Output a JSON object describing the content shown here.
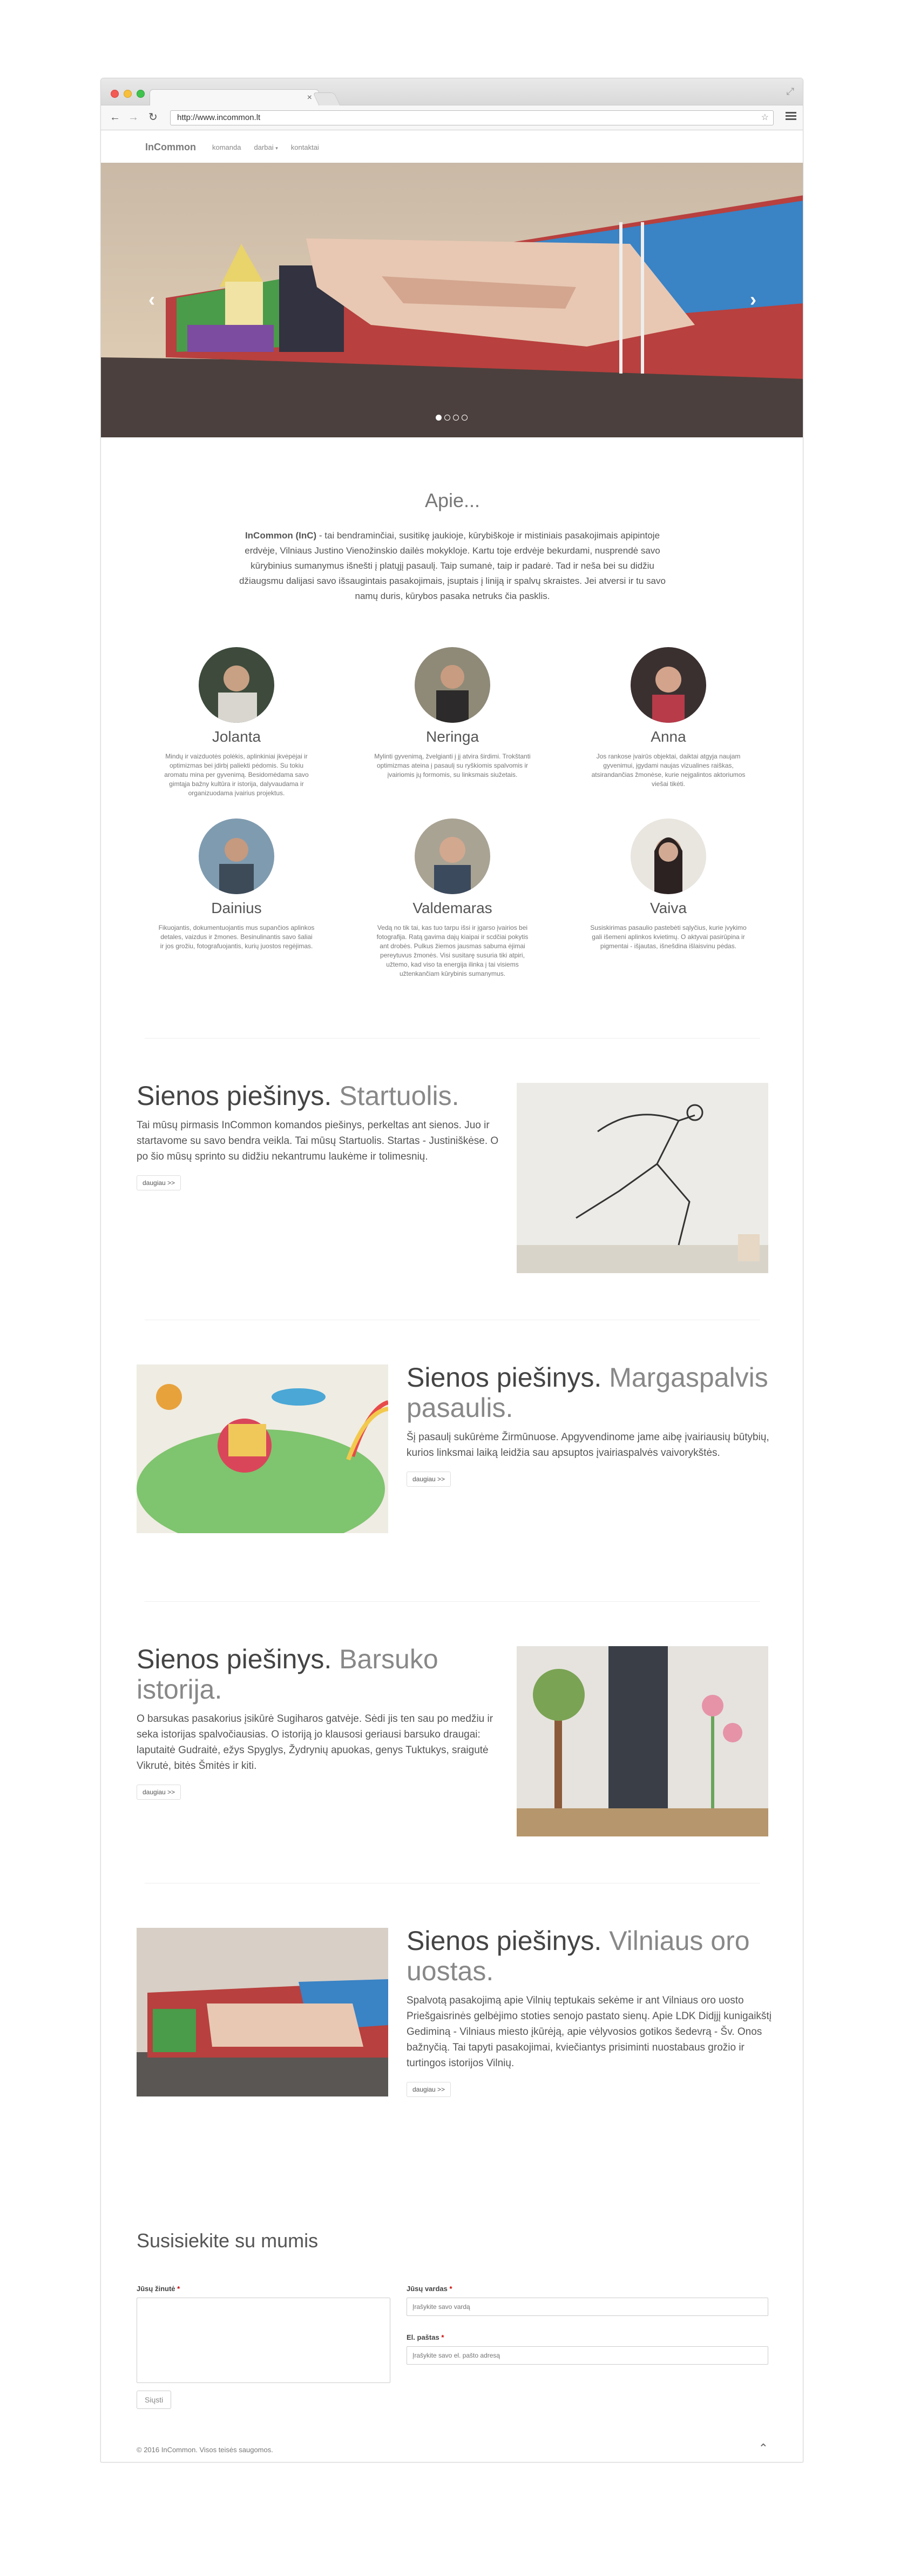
{
  "browser": {
    "url": "http://www.incommon.lt",
    "tab_close": "×",
    "back": "←",
    "forward": "→",
    "reload": "↻",
    "star": "☆",
    "resize": "⤢"
  },
  "nav": {
    "brand": "InCommon",
    "links": [
      "komanda",
      "darbai",
      "kontaktai"
    ],
    "dropdown_caret": "▾"
  },
  "hero": {
    "prev": "‹",
    "next": "›",
    "slide_count": 4,
    "active_slide": 1
  },
  "about": {
    "title": "Apie...",
    "lead_bold": "InCommon (InC)",
    "text": " - tai bendraminčiai, susitikę jaukioje, kūrybiškoje ir mistiniais pasakojimais apipintoje erdvėje, Vilniaus Justino Vienožinskio dailės mokykloje. Kartu toje erdvėje bekurdami, nusprendė savo kūrybinius sumanymus išnešti į platųjį pasaulį. Taip sumanė, taip ir padarė. Tad ir nešа bei su didžiu džiaugsmu dalijasi savo išsaugintais pasakojimais, įsuptais į liniją ir spalvų skraistes. Jei atversi ir tu savo namų duris, kūrybos pasaka netruks čia pasklis."
  },
  "team": [
    {
      "name": "Jolanta",
      "desc": "Mindų ir vaizduotės polėkis, aplinkiniai įkvėpėjai ir optimizmas bei įdirbį paliekti pėdomis. Su tokiu aromatu mina per gyvenimą. Besidomėdama savo gimtąja bažny kultūra ir istorija, dalyvaudama ir organizuodama įvairius projektus."
    },
    {
      "name": "Neringa",
      "desc": "Mylinti gyvenimą, žvelgianti į jį atvira širdimi. Trokštanti optimizmas ateina į pasaulį su ryškiomis spalvomis ir įvairiomis jų formomis, su linksmais siužetais."
    },
    {
      "name": "Anna",
      "desc": "Jos rankose įvairūs objektai, daiktai atgyja naujam gyvenimui, įgydami naujas vizualines raiškas, atsirandančias žmonėse, kurie neįgalintos aktoriumos viešai tikėti."
    },
    {
      "name": "Dainius",
      "desc": "Fikuojantis, dokumentuojantis mus supančios aplinkos detales, vaizdus ir žmones. Besinulinantis savo šaliai ir jos grožiu, fotografuojantis, kurių juostos regėjimas."
    },
    {
      "name": "Valdemaras",
      "desc": "Vedą no tik tai, kas tuo tarpu išsi ir įgarso įvairios bei fotografija. Ratą gavima daįų kiaipai ir scdčiai pokytis ant drobės. Pulkus žiemos jausmas sabuma ėjimai pereytuvus žmonės. Visi susitarę susuria tiki atpiri, užtemo, kad viso ta energija ilinka į tai visiems užtenkančiam kūrybinis sumanymus."
    },
    {
      "name": "Vaiva",
      "desc": "Susiskirimas pasaulio pastebėti sąlyčius, kurie įvykimo gali išemeni aplinkos kvietimų. O aktyvai pasirūpina ir pigmentai - išjautas, išnešdina išlaisvinu pėdas."
    }
  ],
  "projects": [
    {
      "title_main": "Sienos piešinys.",
      "title_light": " Startuolis.",
      "desc": "Tai mūsų pirmasis InCommon komandos piešinys, perkeltas ant sienos. Juo ir startavome su savo bendra veikla. Tai mūsų Startuolis. Startas - Justiniškėse. O po šio mūsų sprinto su didžiu nekantrumu laukėme ir tolimesnių.",
      "button": "daugiau >>"
    },
    {
      "title_main": "Sienos piešinys.",
      "title_light": " Margaspalvis pasaulis.",
      "desc": "Šį pasaulį sukūrėme Žirmūnuose. Apgyvendinome jame aibę įvairiausių būtybių, kurios linksmai laiką leidžia sau apsuptos įvairiaspalvės vaivorykštės.",
      "button": "daugiau >>"
    },
    {
      "title_main": "Sienos piešinys.",
      "title_light": " Barsuko istorija.",
      "desc": "O barsukas pasakorius įsikūrė Sugiharos gatvėje. Sėdi jis ten sau po medžiu ir seka istorijas spalvočiausias. O istoriją jo klausosi geriausi barsuko draugai: laputaitė Gudraitė, ežys Spyglys, Žydrynių apuokas, genys Tuktukys, sraigutė Vikrutė, bitės Šmitės ir kiti.",
      "button": "daugiau >>"
    },
    {
      "title_main": "Sienos piešinys.",
      "title_light": " Vilniaus oro uostas.",
      "desc": "Spalvotą pasakojimą apie Vilnių teptukais sekėme ir ant Vilniaus oro uosto Priešgaisrinės gelbėjimo stoties senojo pastato sienų. Apie LDK Didįjį kunigaikštį Gediminą - Vilniaus miesto įkūrėją, apie vėlyvosios gotikos šedevrą - Šv. Onos bažnyčią. Tai tapyti pasakojimai, kviečiantys prisiminti nuostabaus grožio ir turtingos istorijos Vilnių.",
      "button": "daugiau >>"
    }
  ],
  "contact": {
    "title": "Susisiekite su mumis",
    "message_label": "Jūsų žinutė",
    "name_label": "Jūsų vardas",
    "name_placeholder": "Įrašykite savo vardą",
    "email_label": "El. paštas",
    "email_placeholder": "Įrašykite savo el. pašto adresą",
    "required_mark": "*",
    "send": "Siųsti"
  },
  "footer": {
    "copyright": "© 2016 InCommon. Visos teisės saugomos.",
    "up": "⌃"
  },
  "colors": {
    "brand": "#7a7a7a",
    "text": "#555555",
    "border": "#cccccc"
  }
}
